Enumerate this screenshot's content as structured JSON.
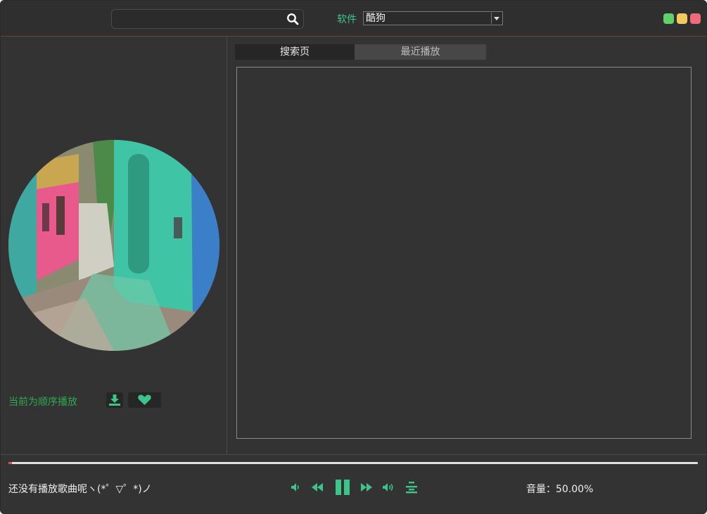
{
  "header": {
    "search": {
      "value": "",
      "placeholder": ""
    },
    "software_label": "软件",
    "source_select": {
      "selected": "酷狗"
    },
    "window_controls": [
      "minimize",
      "maximize",
      "close"
    ]
  },
  "left_panel": {
    "play_mode": "当前为顺序播放",
    "icons": {
      "download": "download-icon",
      "favorite": "heart-icon"
    }
  },
  "tabs": [
    {
      "label": "搜索页",
      "active": true
    },
    {
      "label": "最近播放",
      "active": false
    }
  ],
  "player": {
    "now_playing": "还没有播放歌曲呢ヽ(*゜▽゜*)ノ",
    "progress": 0.005,
    "volume_label": "音量：",
    "volume_value": "50.00%",
    "controls": [
      "volume-down",
      "previous",
      "pause",
      "next",
      "volume-up",
      "playlist"
    ]
  },
  "colors": {
    "accent": "#3cc48a",
    "play_mode_text": "#2fa84f",
    "background": "#333333",
    "progress_fill": "#d9534f"
  }
}
